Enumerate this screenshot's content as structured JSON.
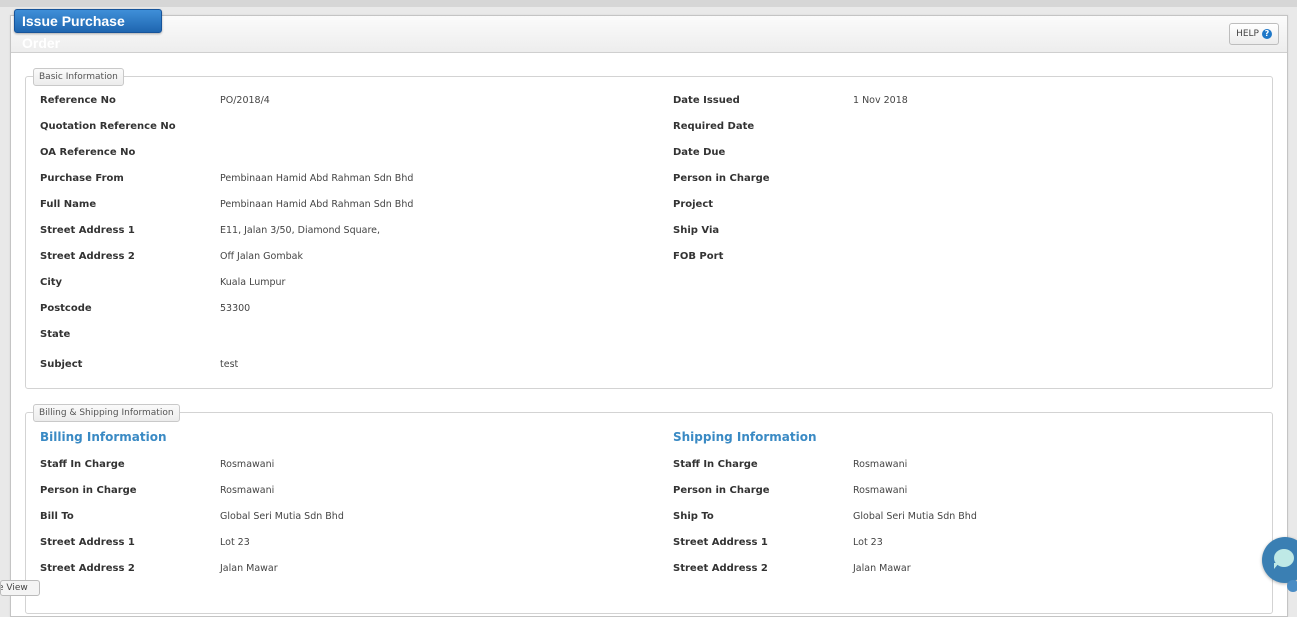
{
  "page": {
    "title": "Issue Purchase Order",
    "help_label": "HELP",
    "help_icon": "question-circle-icon"
  },
  "basic_info": {
    "legend": "Basic Information",
    "left": [
      {
        "label": "Reference No",
        "value": "PO/2018/4"
      },
      {
        "label": "Quotation Reference No",
        "value": ""
      },
      {
        "label": "OA Reference No",
        "value": ""
      },
      {
        "label": "Purchase From",
        "value": "Pembinaan Hamid Abd Rahman Sdn Bhd"
      },
      {
        "label": "Full Name",
        "value": "Pembinaan Hamid Abd Rahman Sdn Bhd"
      },
      {
        "label": "Street Address 1",
        "value": "E11, Jalan 3/50, Diamond Square,"
      },
      {
        "label": "Street Address 2",
        "value": "Off Jalan Gombak"
      },
      {
        "label": "City",
        "value": "Kuala Lumpur"
      },
      {
        "label": "Postcode",
        "value": "53300"
      },
      {
        "label": "State",
        "value": ""
      },
      {
        "label": "Subject",
        "value": "test"
      }
    ],
    "right": [
      {
        "label": "Date Issued",
        "value": "1 Nov 2018"
      },
      {
        "label": "Required Date",
        "value": ""
      },
      {
        "label": "Date Due",
        "value": ""
      },
      {
        "label": "Person in Charge",
        "value": ""
      },
      {
        "label": "Project",
        "value": ""
      },
      {
        "label": "Ship Via",
        "value": ""
      },
      {
        "label": "FOB Port",
        "value": ""
      }
    ]
  },
  "billing_shipping": {
    "legend": "Billing & Shipping Information",
    "billing": {
      "title": "Billing Information",
      "fields": [
        {
          "label": "Staff In Charge",
          "value": "Rosmawani"
        },
        {
          "label": "Person in Charge",
          "value": "Rosmawani"
        },
        {
          "label": "Bill To",
          "value": "Global Seri Mutia Sdn Bhd"
        },
        {
          "label": "Street Address 1",
          "value": "Lot 23"
        },
        {
          "label": "Street Address 2",
          "value": "Jalan Mawar"
        }
      ]
    },
    "shipping": {
      "title": "Shipping Information",
      "fields": [
        {
          "label": "Staff In Charge",
          "value": "Rosmawani"
        },
        {
          "label": "Person in Charge",
          "value": "Rosmawani"
        },
        {
          "label": "Ship To",
          "value": "Global Seri Mutia Sdn Bhd"
        },
        {
          "label": "Street Address 1",
          "value": "Lot 23"
        },
        {
          "label": "Street Address 2",
          "value": "Jalan Mawar"
        }
      ]
    }
  },
  "footer": {
    "corner_tab_label": "e View",
    "chat_icon": "chat-bubble-icon"
  },
  "colors": {
    "title_tab": "#2a78c4",
    "section_title": "#3a8ac4",
    "chat_bubble": "#3a7fb3"
  }
}
